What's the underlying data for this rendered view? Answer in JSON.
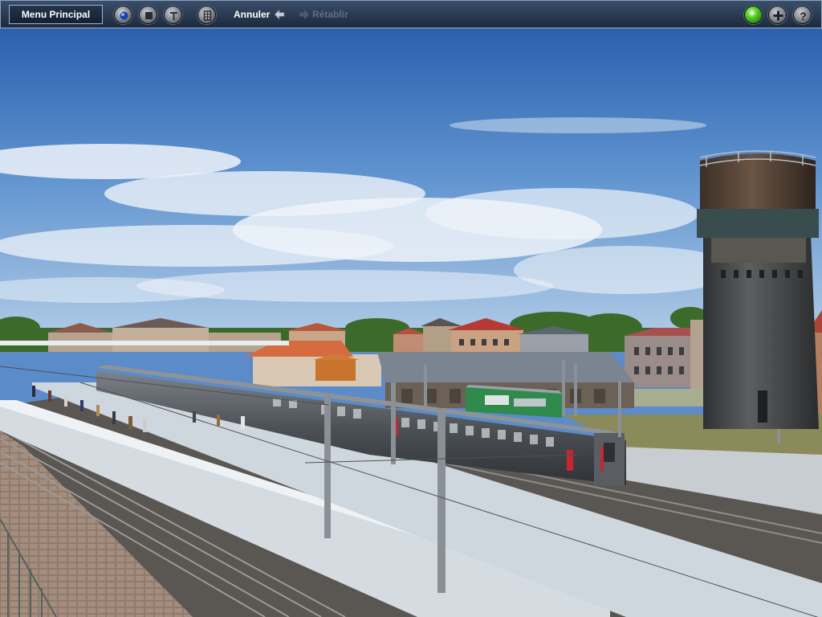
{
  "toolbar": {
    "main_menu_label": "Menu Principal",
    "undo_label": "Annuler",
    "redo_label": "Rétablir",
    "left_icons": [
      "record-icon",
      "stop-icon",
      "wrench-icon",
      "grid-icon"
    ],
    "right_icons": [
      "green-status-icon",
      "add-icon",
      "help-icon"
    ]
  },
  "scene": {
    "description_icons": [
      "water-tower",
      "station-hall",
      "passenger-coaches",
      "locomotive",
      "platforms",
      "catenary-masts",
      "town-houses"
    ],
    "colors": {
      "sky_top": "#2f66b3",
      "sky_bottom": "#a8c6e4",
      "platform": "#d6dde3",
      "tower": "#4a4c4e",
      "coach": "#4d5257",
      "locomotive": "#2e8a4a"
    }
  }
}
